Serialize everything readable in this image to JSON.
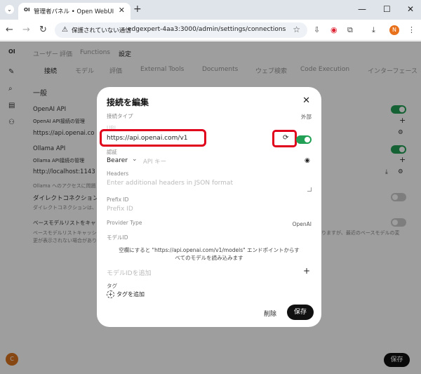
{
  "browser": {
    "tab_favicon": "OI",
    "tab_title": "管理者パネル • Open WebUI",
    "new_tab": "+",
    "security_label": "保護されていない通信",
    "address": "edgexpert-4aa3:3000/admin/settings/connections",
    "profile_initial": "N"
  },
  "app": {
    "logo": "OI",
    "topnav": [
      "ユーザー",
      "評価",
      "Functions",
      "設定"
    ],
    "subnav": [
      "接続",
      "モデル",
      "評価",
      "External Tools",
      "Documents",
      "ウェブ検索",
      "Code Execution",
      "インターフェース"
    ],
    "section_title": "一般",
    "openai_label": "OpenAI API",
    "openai_manage": "OpenAI API接続の管理",
    "openai_url": "https://api.openai.co",
    "ollama_label": "Ollama API",
    "ollama_manage": "Ollama API接続の管理",
    "ollama_url": "http://localhost:1143",
    "ollama_help": "Ollama へのアクセスに問題",
    "direct_title": "ダイレクトコネクション",
    "direct_help": "ダイレクトコネクションは、ユー",
    "cache_title": "ベースモデルリストをキャッシュ",
    "cache_help_1": "ベースモデルリストキャッシュは、",
    "cache_help_2": "更が表示されない場合があり",
    "cache_help_right": "りますが、最近のベースモデルの変",
    "user_initial": "C",
    "save_label": "保存"
  },
  "modal": {
    "title": "接続を編集",
    "connection_type_label": "接続タイプ",
    "connection_type_value": "外部",
    "url_label": "URL",
    "url_value": "https://api.openai.com/v1",
    "auth_label": "認証",
    "auth_value": "Bearer",
    "api_key_placeholder": "API キー",
    "headers_label": "Headers",
    "headers_placeholder": "Enter additional headers in JSON format",
    "prefix_label": "Prefix ID",
    "prefix_placeholder": "Prefix ID",
    "provider_label": "Provider Type",
    "provider_value": "OpenAI",
    "model_ids_label": "モデルID",
    "model_note_1": "空欄にすると \"https://api.openai.com/v1/models\" エンドポイントからす",
    "model_note_2": "べてのモデルを読み込みます",
    "add_model_placeholder": "モデルIDを追加",
    "tags_label": "タグ",
    "add_tag": "タグを追加",
    "delete_label": "削除",
    "save_label": "保存"
  }
}
